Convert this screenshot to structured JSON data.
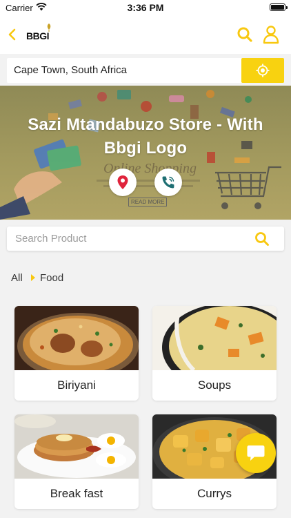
{
  "status_bar": {
    "carrier": "Carrier",
    "time": "3:36 PM"
  },
  "header": {
    "logo_text": "BBGI"
  },
  "location": {
    "value": "Cape Town, South Africa"
  },
  "banner": {
    "title": "Sazi Mtandabuzo Store - With Bbgi Logo",
    "read_more": "READ MORE"
  },
  "product_search": {
    "placeholder": "Search Product"
  },
  "breadcrumb": {
    "all": "All",
    "current": "Food"
  },
  "categories": [
    {
      "label": "Biriyani"
    },
    {
      "label": "Soups"
    },
    {
      "label": "Break fast"
    },
    {
      "label": "Currys"
    }
  ],
  "colors": {
    "accent": "#f8d210",
    "pin": "#e0243c",
    "phone": "#1f6f73"
  },
  "icons": [
    "wifi-icon",
    "battery-icon",
    "back-chevron-icon",
    "search-icon",
    "user-icon",
    "locate-icon",
    "map-pin-icon",
    "phone-icon",
    "chat-icon"
  ]
}
